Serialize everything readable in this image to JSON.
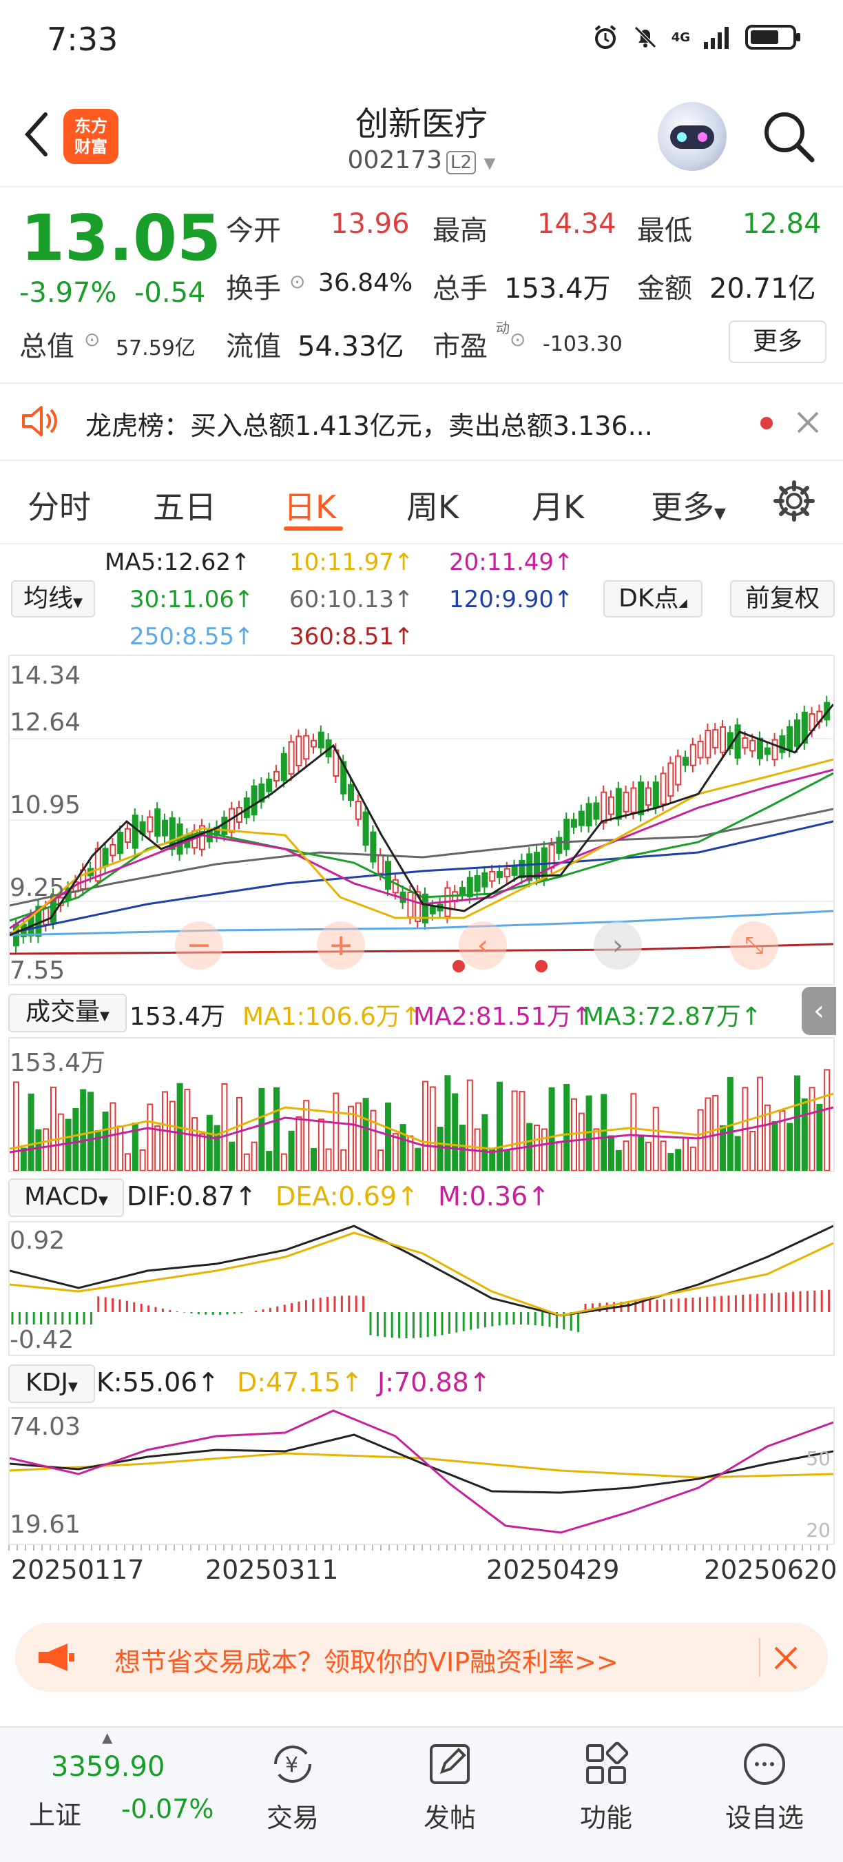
{
  "status": {
    "time": "7:33",
    "network": "4G"
  },
  "header": {
    "title": "创新医疗",
    "code": "002173",
    "code_badge": "L2",
    "logo_line1": "东方",
    "logo_line2": "财富"
  },
  "quote": {
    "price": "13.05",
    "change_pct": "-3.97%",
    "change": "-0.54",
    "open_label": "今开",
    "open": "13.96",
    "high_label": "最高",
    "high": "14.34",
    "low_label": "最低",
    "low": "12.84",
    "turnover_label": "换手",
    "turnover": "36.84%",
    "volume_label": "总手",
    "volume": "153.4万",
    "amount_label": "金额",
    "amount": "20.71亿",
    "mktcap_label": "总值",
    "mktcap": "57.59亿",
    "float_label": "流值",
    "float": "54.33亿",
    "pe_label": "市盈",
    "pe_sup": "动",
    "pe": "-103.30",
    "more_label": "更多"
  },
  "notice": {
    "text": "龙虎榜：买入总额1.413亿元，卖出总额3.136..."
  },
  "tabs": [
    "分时",
    "五日",
    "日K",
    "周K",
    "月K",
    "更多"
  ],
  "active_tab": 2,
  "ma": {
    "selector": "均线",
    "ma5": "MA5:12.62↑",
    "ma10": "10:11.97↑",
    "ma20": "20:11.49↑",
    "ma30": "30:11.06↑",
    "ma60": "60:10.13↑",
    "ma120": "120:9.90↑",
    "ma250": "250:8.55↑",
    "ma360": "360:8.51↑",
    "dk": "DK点",
    "adjust": "前复权"
  },
  "colors": {
    "up": "#e23b3b",
    "down": "#1a9e2a",
    "accent": "#ff5a1f",
    "ma5": "#222222",
    "ma10": "#e6b400",
    "ma20": "#c8209a",
    "ma30": "#1a9e2a",
    "ma60": "#666666",
    "ma120": "#1f3fa8",
    "ma250": "#5aa9e6",
    "ma360": "#b22222"
  },
  "kchart": {
    "y_top": "14.34",
    "y2": "12.64",
    "y3": "10.95",
    "y4": "9.25",
    "y_bottom": "7.55"
  },
  "volume": {
    "selector": "成交量",
    "current": "153.4万",
    "ma1": "MA1:106.6万↑",
    "ma2": "MA2:81.51万↑",
    "ma3": "MA3:72.87万↑",
    "axis_top": "153.4万"
  },
  "macd": {
    "selector": "MACD",
    "dif": "DIF:0.87↑",
    "dea": "DEA:0.69↑",
    "m": "M:0.36↑",
    "axis_top": "0.92",
    "axis_bottom": "-0.42"
  },
  "kdj": {
    "selector": "KDJ",
    "k": "K:55.06↑",
    "d": "D:47.15↑",
    "j": "J:70.88↑",
    "axis_top": "74.03",
    "axis_bottom": "19.61",
    "level_high": "50",
    "level_low": "20"
  },
  "dates": [
    "20250117",
    "20250311",
    "20250429",
    "20250620"
  ],
  "promo": {
    "text": "想节省交易成本？领取你的VIP融资利率>>"
  },
  "bottom_nav": {
    "index_value": "3359.90",
    "index_name": "上证",
    "index_change": "-0.07%",
    "items": [
      "交易",
      "发帖",
      "功能",
      "设自选"
    ]
  }
}
